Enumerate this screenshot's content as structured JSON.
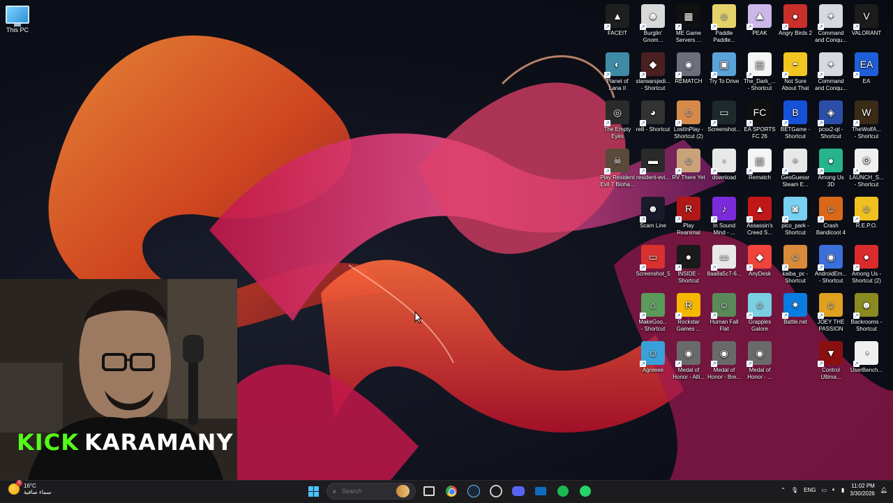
{
  "desktop": {
    "this_pc_label": "This PC"
  },
  "icons": [
    {
      "label": "FACEIT",
      "color": "#1f1f1f",
      "glyph": "▲"
    },
    {
      "label": "Burglin'\nGnom...",
      "color": "#d9d9d9",
      "glyph": "☻"
    },
    {
      "label": "ME Game\nServers ...",
      "color": "#111",
      "glyph": "▦"
    },
    {
      "label": "Paddle\nPaddle...",
      "color": "#e4d36a",
      "glyph": "☺"
    },
    {
      "label": "PEAK",
      "color": "#cbb7e8",
      "glyph": "⛰"
    },
    {
      "label": "Angry Birds 2",
      "color": "#c8302a",
      "glyph": "●"
    },
    {
      "label": "Command\nand Conqu...",
      "color": "#d7d9de",
      "glyph": "✦"
    },
    {
      "label": "VALORANT",
      "color": "#1c1c1c",
      "glyph": "V"
    },
    {
      "label": "Planet of\nLana II",
      "color": "#3f8ba6",
      "glyph": "◐"
    },
    {
      "label": "starwarsjedi...\n- Shortcut",
      "color": "#4a2020",
      "glyph": "◆"
    },
    {
      "label": "REMATCH",
      "color": "#6b6f7a",
      "glyph": "◉"
    },
    {
      "label": "Try To Drive",
      "color": "#5aa3d9",
      "glyph": "▣"
    },
    {
      "label": "The_Dark_...\n- Shortcut",
      "color": "#f5f5f5",
      "glyph": "▤"
    },
    {
      "label": "Not Sure\nAbout That",
      "color": "#f2c620",
      "glyph": "◓"
    },
    {
      "label": "Command\nand Conqu...",
      "color": "#d7d9de",
      "glyph": "✦"
    },
    {
      "label": "EA",
      "color": "#1e5fd9",
      "glyph": "EA"
    },
    {
      "label": "The Empty\nEyes",
      "color": "#2b2b2b",
      "glyph": "◎"
    },
    {
      "label": "re8 - Shortcut",
      "color": "#333",
      "glyph": "◕"
    },
    {
      "label": "LostInPlay -\nShortcut (2)",
      "color": "#d68a4a",
      "glyph": "☺"
    },
    {
      "label": "Screenshot...",
      "color": "#1d2a2c",
      "glyph": "▭"
    },
    {
      "label": "EA SPORTS\nFC 26",
      "color": "#101010",
      "glyph": "FC"
    },
    {
      "label": "BETGame -\nShortcut",
      "color": "#1651d9",
      "glyph": "B"
    },
    {
      "label": "pcsx2-qt -\nShortcut",
      "color": "#2b4fa8",
      "glyph": "◈"
    },
    {
      "label": "TheWolfA...\n- Shortcut",
      "color": "#3a2a16",
      "glyph": "W"
    },
    {
      "label": "Play Resident\nEvil 7 Bioha...",
      "color": "#5a4a3a",
      "glyph": "☠"
    },
    {
      "label": "resident-evi...",
      "color": "#2a2a2a",
      "glyph": "▬"
    },
    {
      "label": "RV There Yet",
      "color": "#c9a27a",
      "glyph": "☺"
    },
    {
      "label": "download",
      "color": "#e8e8e8",
      "glyph": "◦"
    },
    {
      "label": "Rematch",
      "color": "#f5f5f5",
      "glyph": "▤"
    },
    {
      "label": "GeoGuessr\nSteam E...",
      "color": "#e8e8e8",
      "glyph": "⌖"
    },
    {
      "label": "Among Us\n3D",
      "color": "#27b38c",
      "glyph": "●"
    },
    {
      "label": "LAUNCH_S...\n- Shortcut",
      "color": "#f0f0f0",
      "glyph": "⚙"
    },
    {
      "label": "Scam Line",
      "color": "#1a1a2a",
      "glyph": "☻"
    },
    {
      "label": "Play\nReanimal",
      "color": "#b01818",
      "glyph": "R"
    },
    {
      "label": "In Sound\nMind - ...",
      "color": "#7b2bd9",
      "glyph": "♪"
    },
    {
      "label": "Assassin's\nCreed S...",
      "color": "#c01818",
      "glyph": "▲"
    },
    {
      "label": "pico_park -\nShortcut",
      "color": "#7ad0f0",
      "glyph": "◙"
    },
    {
      "label": "Crash\nBandicoot 4",
      "color": "#d9681a",
      "glyph": "☺"
    },
    {
      "label": "R.E.P.O.",
      "color": "#f0c020",
      "glyph": "☺"
    },
    {
      "label": "Screenshot_5",
      "color": "#d93030",
      "glyph": "▭"
    },
    {
      "label": "INSIDE -\nShortcut",
      "color": "#1a1a1a",
      "glyph": "●"
    },
    {
      "label": "8aa8a5c7-6...",
      "color": "#e8e8e8",
      "glyph": "▭"
    },
    {
      "label": "AnyDesk",
      "color": "#ef443b",
      "glyph": "◆"
    },
    {
      "label": "kaiba_pc -\nShortcut",
      "color": "#d98b3a",
      "glyph": "☺"
    },
    {
      "label": "AndroidEm...\n- Shortcut",
      "color": "#3b6fd9",
      "glyph": "◉"
    },
    {
      "label": "Among Us -\nShortcut (2)",
      "color": "#d92b2b",
      "glyph": "●"
    },
    {
      "label": "MakeGoo...\n- Shortcut",
      "color": "#5a9a5a",
      "glyph": "⌂"
    },
    {
      "label": "Rockstar\nGames ...",
      "color": "#f5b800",
      "glyph": "R"
    },
    {
      "label": "Human Fall\nFlat",
      "color": "#5a8a5a",
      "glyph": "☺"
    },
    {
      "label": "Grapples\nGalore",
      "color": "#7ad0e0",
      "glyph": "☺"
    },
    {
      "label": "Battle.net",
      "color": "#0a7be0",
      "glyph": "✷"
    },
    {
      "label": "JOEY THE\nPASSION",
      "color": "#e0a020",
      "glyph": "☺"
    },
    {
      "label": "Backrooms -\nShortcut",
      "color": "#8a8a20",
      "glyph": "☻"
    },
    {
      "label": "Agreeee",
      "color": "#3aa0d9",
      "glyph": "☺"
    },
    {
      "label": "Medal of\nHonor - Alli...",
      "color": "#6a6a6a",
      "glyph": "◉"
    },
    {
      "label": "Medal of\nHonor - Bre...",
      "color": "#6a6a6a",
      "glyph": "◉"
    },
    {
      "label": "Medal of\nHonor - ...",
      "color": "#6a6a6a",
      "glyph": "◉"
    },
    {
      "label": "Control\nUltima...",
      "color": "#8a1010",
      "glyph": "▼"
    },
    {
      "label": "UserBench...",
      "color": "#f0f0f0",
      "glyph": "◔"
    }
  ],
  "webcam": {
    "banner_kick": "KICK",
    "banner_name": "KARAMANY"
  },
  "taskbar": {
    "weather_temp": "16°C",
    "weather_desc": "سماء صافية",
    "weather_badge": "3",
    "search_placeholder": "Search",
    "apps": [
      "file-explorer-icon",
      "chrome-icon",
      "steam-icon",
      "spotify-style-icon",
      "discord-icon",
      "mail-icon",
      "spotify-icon",
      "whatsapp-icon"
    ],
    "language": "ENG",
    "time": "11:02 PM",
    "date": "3/30/2026"
  }
}
